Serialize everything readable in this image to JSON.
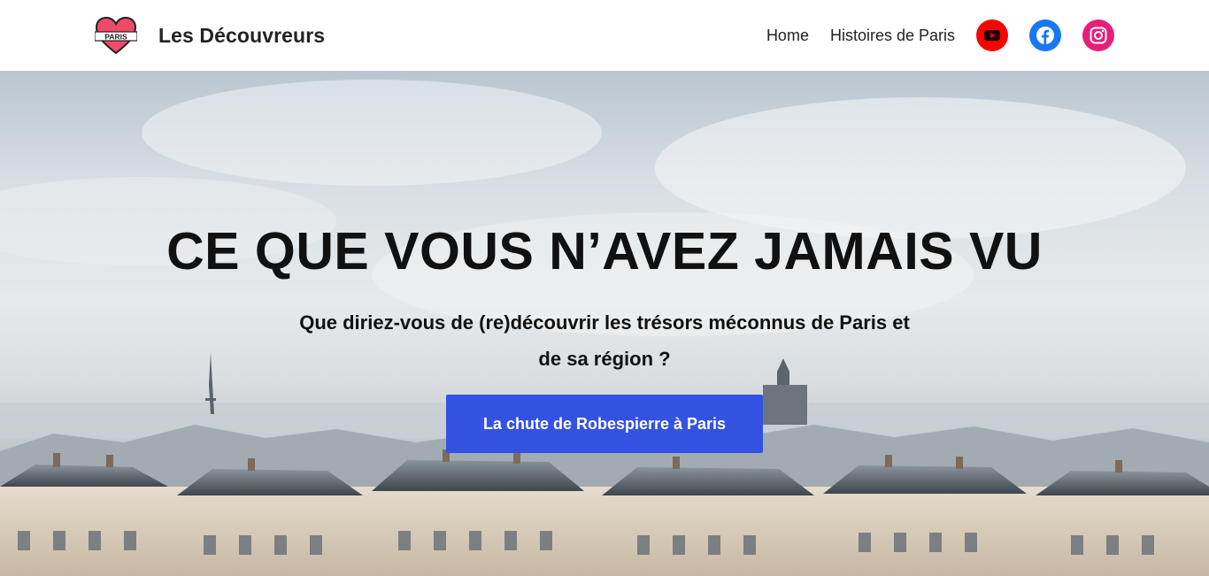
{
  "header": {
    "site_title": "Les Découvreurs",
    "logo_text": "PARIS",
    "nav": [
      {
        "label": "Home"
      },
      {
        "label": "Histoires de Paris"
      }
    ],
    "social": [
      {
        "name": "youtube-icon",
        "color": "#ff0000"
      },
      {
        "name": "facebook-icon",
        "color": "#1877f2"
      },
      {
        "name": "instagram-icon",
        "color": "#e91e78"
      }
    ]
  },
  "hero": {
    "title": "CE QUE VOUS N’AVEZ JAMAIS VU",
    "subtitle": "Que diriez-vous de (re)découvrir les trésors méconnus de Paris et de sa région ?",
    "cta_label": "La chute de Robespierre à Paris",
    "cta_color": "#3452e1"
  }
}
